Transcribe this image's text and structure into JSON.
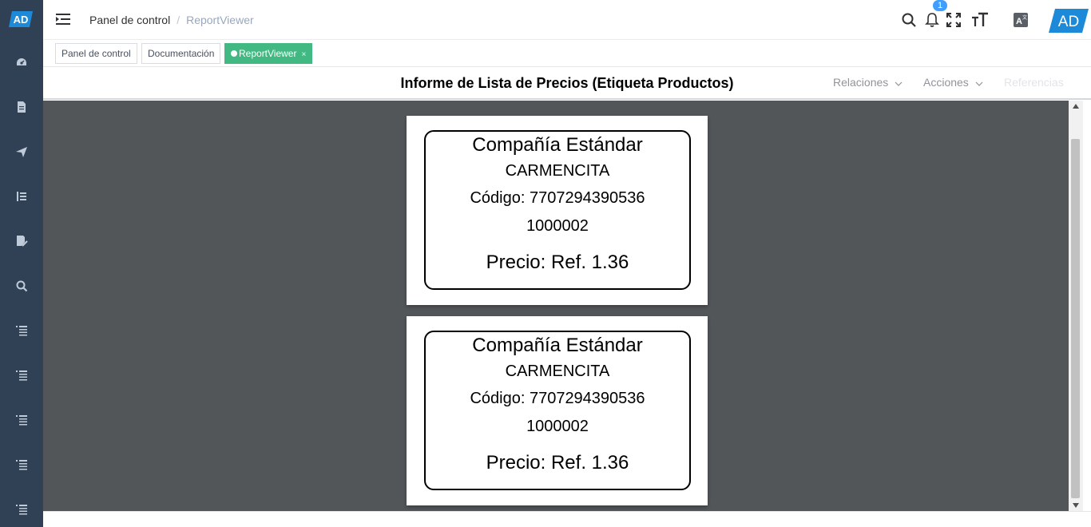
{
  "colors": {
    "sidebar": "#304156",
    "accent": "#42b983",
    "brand": "#1c8ad8",
    "viewer_bg": "#525659"
  },
  "logo": {
    "text": "AD"
  },
  "sidebar": {
    "items": [
      {
        "icon": "dashboard-icon"
      },
      {
        "icon": "document-icon"
      },
      {
        "icon": "send-icon"
      },
      {
        "icon": "tree-list-icon"
      },
      {
        "icon": "edit-document-icon"
      },
      {
        "icon": "search-icon"
      },
      {
        "icon": "list-icon"
      },
      {
        "icon": "list-icon"
      },
      {
        "icon": "list-icon"
      },
      {
        "icon": "list-icon"
      },
      {
        "icon": "list-icon"
      }
    ]
  },
  "header": {
    "breadcrumb": {
      "home": "Panel de control",
      "separator": "/",
      "current": "ReportViewer"
    },
    "notification_count": "1",
    "brand_logo": "AD"
  },
  "tags": [
    {
      "label": "Panel de control"
    },
    {
      "label": "Documentación"
    },
    {
      "label": "ReportViewer",
      "close": "×"
    }
  ],
  "report": {
    "title": "Informe de Lista de Precios (Etiqueta Productos)",
    "menus": {
      "relations": "Relaciones",
      "actions": "Acciones",
      "references": "Referencias"
    }
  },
  "labels": [
    {
      "company": "Compañía Estándar",
      "product": "CARMENCITA",
      "code": "Código: 7707294390536",
      "sku": "1000002",
      "price": "Precio: Ref. 1.36"
    },
    {
      "company": "Compañía Estándar",
      "product": "CARMENCITA",
      "code": "Código: 7707294390536",
      "sku": "1000002",
      "price": "Precio: Ref. 1.36"
    }
  ]
}
